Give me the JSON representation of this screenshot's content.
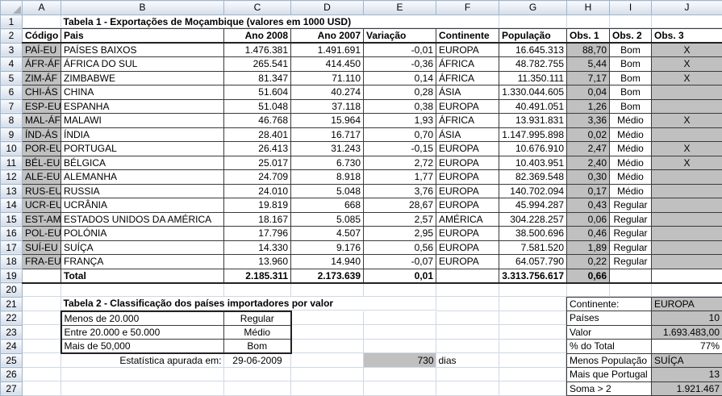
{
  "grid": {
    "column_letters": [
      "A",
      "B",
      "C",
      "D",
      "E",
      "F",
      "G",
      "H",
      "I",
      "J"
    ],
    "row_count": 27
  },
  "table1": {
    "title": "Tabela 1 - Exportações de Moçambique (valores em 1000 USD)",
    "headers": [
      "Código",
      "Pais",
      "Ano 2008",
      "Ano 2007",
      "Variação",
      "Continente",
      "População",
      "Obs. 1",
      "Obs. 2",
      "Obs. 3"
    ],
    "rows": [
      [
        "PAÍ-EU",
        "PAÍSES BAIXOS",
        "1.476.381",
        "1.491.691",
        "-0,01",
        "EUROPA",
        "16.645.313",
        "88,70",
        "Bom",
        "X"
      ],
      [
        "ÁFR-ÁF",
        "ÁFRICA DO SUL",
        "265.541",
        "414.450",
        "-0,36",
        "ÁFRICA",
        "48.782.755",
        "5,44",
        "Bom",
        "X"
      ],
      [
        "ZIM-ÁF",
        "ZIMBABWE",
        "81.347",
        "71.110",
        "0,14",
        "ÁFRICA",
        "11.350.111",
        "7,17",
        "Bom",
        "X"
      ],
      [
        "CHI-ÁS",
        "CHINA",
        "51.604",
        "40.274",
        "0,28",
        "ÁSIA",
        "1.330.044.605",
        "0,04",
        "Bom",
        ""
      ],
      [
        "ESP-EU",
        "ESPANHA",
        "51.048",
        "37.118",
        "0,38",
        "EUROPA",
        "40.491.051",
        "1,26",
        "Bom",
        ""
      ],
      [
        "MAL-ÁF",
        "MALAWI",
        "46.768",
        "15.964",
        "1,93",
        "ÁFRICA",
        "13.931.831",
        "3,36",
        "Médio",
        "X"
      ],
      [
        "ÍND-ÁS",
        "ÍNDIA",
        "28.401",
        "16.717",
        "0,70",
        "ÁSIA",
        "1.147.995.898",
        "0,02",
        "Médio",
        ""
      ],
      [
        "POR-EU",
        "PORTUGAL",
        "26.413",
        "31.243",
        "-0,15",
        "EUROPA",
        "10.676.910",
        "2,47",
        "Médio",
        "X"
      ],
      [
        "BÉL-EU",
        "BÉLGICA",
        "25.017",
        "6.730",
        "2,72",
        "EUROPA",
        "10.403.951",
        "2,40",
        "Médio",
        "X"
      ],
      [
        "ALE-EU",
        "ALEMANHA",
        "24.709",
        "8.918",
        "1,77",
        "EUROPA",
        "82.369.548",
        "0,30",
        "Médio",
        ""
      ],
      [
        "RUS-EU",
        "RUSSIA",
        "24.010",
        "5.048",
        "3,76",
        "EUROPA",
        "140.702.094",
        "0,17",
        "Médio",
        ""
      ],
      [
        "UCR-EU",
        "UCRÂNIA",
        "19.819",
        "668",
        "28,67",
        "EUROPA",
        "45.994.287",
        "0,43",
        "Regular",
        ""
      ],
      [
        "EST-AM",
        "ESTADOS UNIDOS DA AMÉRICA",
        "18.167",
        "5.085",
        "2,57",
        "AMÉRICA",
        "304.228.257",
        "0,06",
        "Regular",
        ""
      ],
      [
        "POL-EU",
        "POLÓNIA",
        "17.796",
        "4.507",
        "2,95",
        "EUROPA",
        "38.500.696",
        "0,46",
        "Regular",
        ""
      ],
      [
        "SUÍ-EU",
        "SUÍÇA",
        "14.330",
        "9.176",
        "0,56",
        "EUROPA",
        "7.581.520",
        "1,89",
        "Regular",
        ""
      ],
      [
        "FRA-EU",
        "FRANÇA",
        "13.960",
        "14.940",
        "-0,07",
        "EUROPA",
        "64.057.790",
        "0,22",
        "Regular",
        ""
      ]
    ],
    "total": {
      "label": "Total",
      "y2008": "2.185.311",
      "y2007": "2.173.639",
      "variation": "0,01",
      "population": "3.313.756.617",
      "obs1": "0,66"
    }
  },
  "table2": {
    "title": "Tabela 2 - Classificação dos países importadores por valor",
    "rows": [
      [
        "Menos de 20.000",
        "Regular"
      ],
      [
        "Entre 20.000 e 50.000",
        "Médio"
      ],
      [
        "Mais de 50,000",
        "Bom"
      ]
    ],
    "stat_label": "Estatística apurada em:",
    "stat_date": "29-06-2009",
    "days_value": "730",
    "days_unit": "dias"
  },
  "summary": {
    "rows": [
      {
        "label": "Continente:",
        "value": "EUROPA"
      },
      {
        "label": "Países",
        "value": "10"
      },
      {
        "label": "Valor",
        "value": "1.693.483,00"
      },
      {
        "label": "% do Total",
        "value": "77%"
      },
      {
        "label": "Menos População",
        "value": "SUÍÇA"
      },
      {
        "label": "Mais que Portugal",
        "value": "13"
      },
      {
        "label": "Soma > 2",
        "value": "1.921.467"
      }
    ]
  },
  "colors": {
    "gray_fill": "#c0c0c0",
    "grid_line": "#d0d7e5",
    "table_border": "#3a3a3a",
    "header_border": "#9eb6ce",
    "header_text": "#3c4f6b"
  }
}
